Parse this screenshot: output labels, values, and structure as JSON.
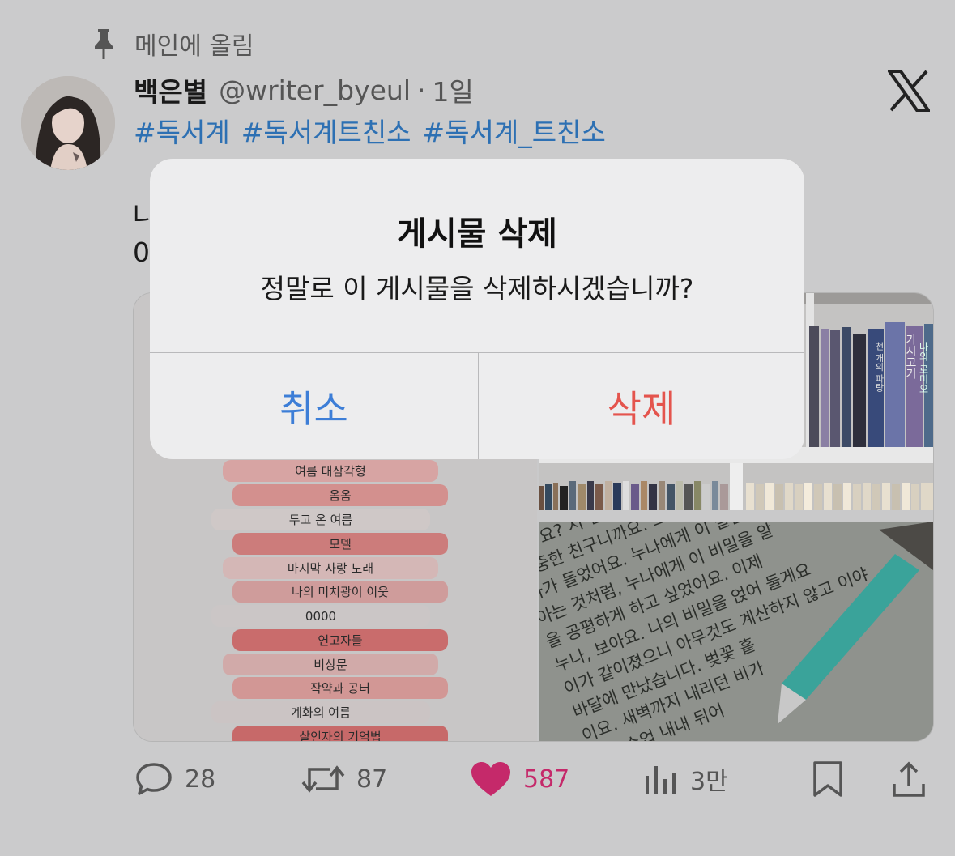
{
  "pinned": {
    "label": "메인에 올림",
    "icon": "pin-icon"
  },
  "post": {
    "display_name": "백은별",
    "handle": "@writer_byeul",
    "separator": "·",
    "time": "1일",
    "hashtags": [
      "#독서계",
      "#독서계트친소",
      "#독서계_트친소"
    ],
    "body_lines": [
      "나",
      "0"
    ]
  },
  "media": {
    "left_list": [
      "여름 대삼각형",
      "옴옴",
      "두고 온 여름",
      "모델",
      "마지막 사랑 노래",
      "나의 미치광이 이웃",
      "0000",
      "연고자들",
      "비상문",
      "작약과 공터",
      "계화의 여름",
      "살인자의 기억법"
    ],
    "book_spines": [
      "가시고기",
      "나의 로미오",
      "천 개의 파랑"
    ],
    "page_text": [
      "왔나요? 저 친구니까 친",
      "소중한 친구니까요. 그리고 내가",
      "나가 들었어요. 누나에게 이 말을 할",
      "아는 것처럼, 누나에게 이 비밀을 알",
      "을 공평하게 하고 싶었어요. 이제",
      "누나, 보아요. 나의 비밀을 얹어 둘게요",
      "이가 같이졌으니 아무것도 계산하지 않고 이야",
      "바달에 만났습니다. 벚꽃 흩",
      "이요. 새벽까지 내리던 비가",
      "에서 수업 내내 뒤어"
    ]
  },
  "actions": {
    "reply_count": "28",
    "repost_count": "87",
    "like_count": "587",
    "views_count": "3만"
  },
  "dialog": {
    "title": "게시물 삭제",
    "message": "정말로 이 게시물을 삭제하시겠습니까?",
    "cancel_label": "취소",
    "delete_label": "삭제"
  },
  "colors": {
    "hashtag": "#2d70b3",
    "like": "#c5296a",
    "cancel": "#3d7ed7",
    "delete": "#e4544d"
  }
}
